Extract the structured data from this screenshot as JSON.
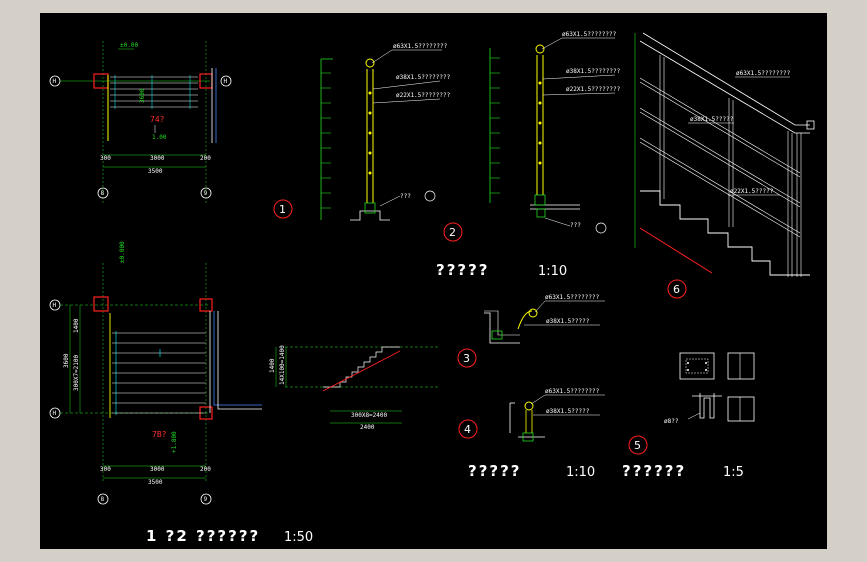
{
  "colors": {
    "background": "#000000",
    "frame": "#d4d0c8",
    "line_green": "#22dd22",
    "line_white": "#ffffff",
    "line_red": "#ff2020",
    "line_yellow": "#ffff00",
    "line_cyan": "#00ffff"
  },
  "plan_top": {
    "axis_left": "H",
    "axis_right": "H",
    "axis_bottom_left": "8",
    "axis_bottom_right": "9",
    "dim_left": "300",
    "dim_mid": "3000",
    "dim_right": "200",
    "dim_total": "3500",
    "level_tag": "±0.00",
    "dim_vertical": "3600",
    "red_mark": "74?",
    "small_tag": "1.00"
  },
  "plan_bottom": {
    "axis_top": "H",
    "axis_bottom": "H",
    "axis_bottom_left": "8",
    "axis_bottom_right": "9",
    "dim_top": "1400",
    "dim_v_total": "3600",
    "dim_v_sub": "300X7=2100",
    "dim_left": "300",
    "dim_mid": "3000",
    "dim_right": "200",
    "dim_total": "3500",
    "red_mark": "7B?",
    "level_tag_top": "±0.000",
    "level_tag_bottom": "+1.800"
  },
  "detail1": {
    "number": "1",
    "pipe_top": "ø63X1.5????????",
    "pipe_mid": "ø38X1.5????????",
    "pipe_low": "ø22X1.5????????",
    "base_note": "???"
  },
  "detail2": {
    "number": "2",
    "pipe_top": "ø63X1.5????????",
    "pipe_mid": "ø38X1.5????????",
    "pipe_low": "ø22X1.5????????",
    "base_note": "???"
  },
  "detail3": {
    "number": "3",
    "pipe_top": "ø63X1.5????????",
    "pipe_low": "ø38X1.5?????"
  },
  "detail4": {
    "number": "4",
    "pipe_top": "ø63X1.5????????",
    "pipe_low": "ø38X1.5?????"
  },
  "detail5": {
    "number": "5",
    "note": "ø8??"
  },
  "detail6": {
    "number": "6",
    "pipe_top": "ø63X1.5????????",
    "pipe_mid": "ø38X1.5?????",
    "pipe_low": "ø22X1.5?????"
  },
  "stair_section": {
    "dim_height": "1400",
    "dim_vert_calc": "14X100=1400",
    "dim_run": "300X8=2400",
    "dim_total": "2400"
  },
  "titles": {
    "details_12": "?????",
    "details_12_scale": "1:10",
    "details_34": "?????",
    "details_34_scale": "1:10",
    "details_5": "??????",
    "details_5_scale": "1:5",
    "plans": "1 ?2 ??????",
    "plans_scale": "1:50"
  }
}
